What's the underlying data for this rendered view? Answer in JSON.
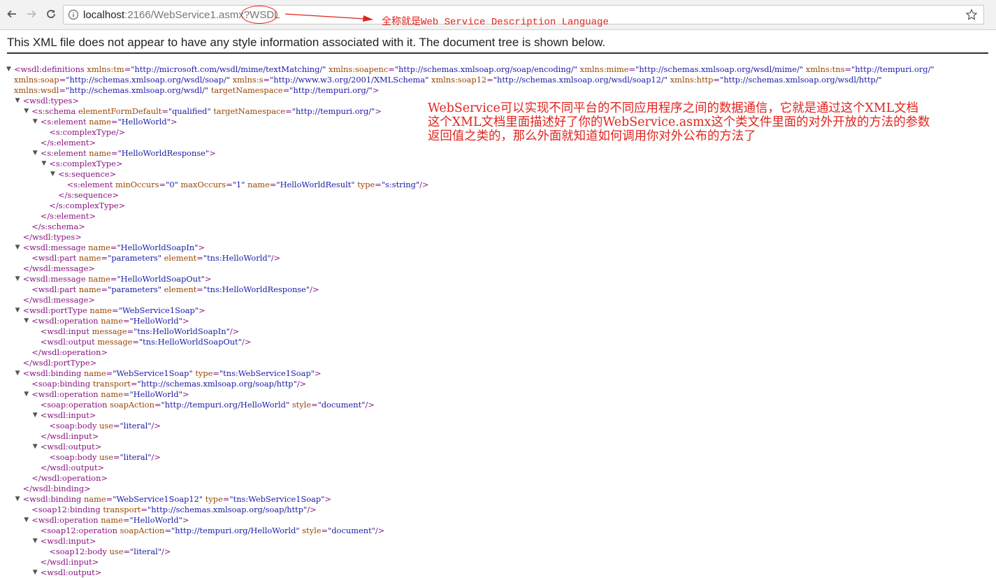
{
  "browser": {
    "url_host": "localhost",
    "url_rest": ":2166/WebService1.asmx?WSDL",
    "annotation": "全称就是Web Service Description Language"
  },
  "page": {
    "message": "This XML file does not appear to have any style information associated with it. The document tree is shown below."
  },
  "annotation": {
    "lines": [
      "WebService可以实现不同平台的不同应用程序之间的数据通信，它就是通过这个XML文档",
      "这个XML文档里面描述好了你的WebService.asmx这个类文件里面的对外开放的方法的参数",
      "返回值之类的，那么外面就知道如何调用你对外公布的方法了"
    ]
  },
  "xml_lines": [
    {
      "indent": 0,
      "toggle": true,
      "tag": "<wsdl:definitions",
      "attrs": [
        [
          "xmlns:tm",
          "http://microsoft.com/wsdl/mime/textMatching/"
        ],
        [
          "xmlns:soapenc",
          "http://schemas.xmlsoap.org/soap/encoding/"
        ],
        [
          "xmlns:mime",
          "http://schemas.xmlsoap.org/wsdl/mime/"
        ],
        [
          "xmlns:tns",
          "http://tempuri.org/"
        ]
      ],
      "end": ""
    },
    {
      "indent": 0,
      "toggle": false,
      "wrap": true,
      "tag": "",
      "attrs": [
        [
          "xmlns:soap",
          "http://schemas.xmlsoap.org/wsdl/soap/"
        ],
        [
          "xmlns:s",
          "http://www.w3.org/2001/XMLSchema"
        ],
        [
          "xmlns:soap12",
          "http://schemas.xmlsoap.org/wsdl/soap12/"
        ],
        [
          "xmlns:http",
          "http://schemas.xmlsoap.org/wsdl/http/"
        ]
      ],
      "end": ""
    },
    {
      "indent": 0,
      "toggle": false,
      "wrap": true,
      "tag": "",
      "attrs": [
        [
          "xmlns:wsdl",
          "http://schemas.xmlsoap.org/wsdl/"
        ],
        [
          "targetNamespace",
          "http://tempuri.org/"
        ]
      ],
      "end": ">"
    },
    {
      "indent": 1,
      "toggle": true,
      "tag": "<wsdl:types",
      "attrs": [],
      "end": ">"
    },
    {
      "indent": 2,
      "toggle": true,
      "tag": "<s:schema",
      "attrs": [
        [
          "elementFormDefault",
          "qualified"
        ],
        [
          "targetNamespace",
          "http://tempuri.org/"
        ]
      ],
      "end": ">"
    },
    {
      "indent": 3,
      "toggle": true,
      "tag": "<s:element",
      "attrs": [
        [
          "name",
          "HelloWorld"
        ]
      ],
      "end": ">"
    },
    {
      "indent": 4,
      "toggle": false,
      "tag": "<s:complexType/>",
      "attrs": [],
      "end": ""
    },
    {
      "indent": 3,
      "toggle": false,
      "tag": "</s:element>",
      "attrs": [],
      "end": ""
    },
    {
      "indent": 3,
      "toggle": true,
      "tag": "<s:element",
      "attrs": [
        [
          "name",
          "HelloWorldResponse"
        ]
      ],
      "end": ">"
    },
    {
      "indent": 4,
      "toggle": true,
      "tag": "<s:complexType",
      "attrs": [],
      "end": ">"
    },
    {
      "indent": 5,
      "toggle": true,
      "tag": "<s:sequence",
      "attrs": [],
      "end": ">"
    },
    {
      "indent": 6,
      "toggle": false,
      "tag": "<s:element",
      "attrs": [
        [
          "minOccurs",
          "0"
        ],
        [
          "maxOccurs",
          "1"
        ],
        [
          "name",
          "HelloWorldResult"
        ],
        [
          "type",
          "s:string"
        ]
      ],
      "end": "/>"
    },
    {
      "indent": 5,
      "toggle": false,
      "tag": "</s:sequence>",
      "attrs": [],
      "end": ""
    },
    {
      "indent": 4,
      "toggle": false,
      "tag": "</s:complexType>",
      "attrs": [],
      "end": ""
    },
    {
      "indent": 3,
      "toggle": false,
      "tag": "</s:element>",
      "attrs": [],
      "end": ""
    },
    {
      "indent": 2,
      "toggle": false,
      "tag": "</s:schema>",
      "attrs": [],
      "end": ""
    },
    {
      "indent": 1,
      "toggle": false,
      "tag": "</wsdl:types>",
      "attrs": [],
      "end": ""
    },
    {
      "indent": 1,
      "toggle": true,
      "tag": "<wsdl:message",
      "attrs": [
        [
          "name",
          "HelloWorldSoapIn"
        ]
      ],
      "end": ">"
    },
    {
      "indent": 2,
      "toggle": false,
      "tag": "<wsdl:part",
      "attrs": [
        [
          "name",
          "parameters"
        ],
        [
          "element",
          "tns:HelloWorld"
        ]
      ],
      "end": "/>"
    },
    {
      "indent": 1,
      "toggle": false,
      "tag": "</wsdl:message>",
      "attrs": [],
      "end": ""
    },
    {
      "indent": 1,
      "toggle": true,
      "tag": "<wsdl:message",
      "attrs": [
        [
          "name",
          "HelloWorldSoapOut"
        ]
      ],
      "end": ">"
    },
    {
      "indent": 2,
      "toggle": false,
      "tag": "<wsdl:part",
      "attrs": [
        [
          "name",
          "parameters"
        ],
        [
          "element",
          "tns:HelloWorldResponse"
        ]
      ],
      "end": "/>"
    },
    {
      "indent": 1,
      "toggle": false,
      "tag": "</wsdl:message>",
      "attrs": [],
      "end": ""
    },
    {
      "indent": 1,
      "toggle": true,
      "tag": "<wsdl:portType",
      "attrs": [
        [
          "name",
          "WebService1Soap"
        ]
      ],
      "end": ">"
    },
    {
      "indent": 2,
      "toggle": true,
      "tag": "<wsdl:operation",
      "attrs": [
        [
          "name",
          "HelloWorld"
        ]
      ],
      "end": ">"
    },
    {
      "indent": 3,
      "toggle": false,
      "tag": "<wsdl:input",
      "attrs": [
        [
          "message",
          "tns:HelloWorldSoapIn"
        ]
      ],
      "end": "/>"
    },
    {
      "indent": 3,
      "toggle": false,
      "tag": "<wsdl:output",
      "attrs": [
        [
          "message",
          "tns:HelloWorldSoapOut"
        ]
      ],
      "end": "/>"
    },
    {
      "indent": 2,
      "toggle": false,
      "tag": "</wsdl:operation>",
      "attrs": [],
      "end": ""
    },
    {
      "indent": 1,
      "toggle": false,
      "tag": "</wsdl:portType>",
      "attrs": [],
      "end": ""
    },
    {
      "indent": 1,
      "toggle": true,
      "tag": "<wsdl:binding",
      "attrs": [
        [
          "name",
          "WebService1Soap"
        ],
        [
          "type",
          "tns:WebService1Soap"
        ]
      ],
      "end": ">"
    },
    {
      "indent": 2,
      "toggle": false,
      "tag": "<soap:binding",
      "attrs": [
        [
          "transport",
          "http://schemas.xmlsoap.org/soap/http"
        ]
      ],
      "end": "/>"
    },
    {
      "indent": 2,
      "toggle": true,
      "tag": "<wsdl:operation",
      "attrs": [
        [
          "name",
          "HelloWorld"
        ]
      ],
      "end": ">"
    },
    {
      "indent": 3,
      "toggle": false,
      "tag": "<soap:operation",
      "attrs": [
        [
          "soapAction",
          "http://tempuri.org/HelloWorld"
        ],
        [
          "style",
          "document"
        ]
      ],
      "end": "/>"
    },
    {
      "indent": 3,
      "toggle": true,
      "tag": "<wsdl:input",
      "attrs": [],
      "end": ">"
    },
    {
      "indent": 4,
      "toggle": false,
      "tag": "<soap:body",
      "attrs": [
        [
          "use",
          "literal"
        ]
      ],
      "end": "/>"
    },
    {
      "indent": 3,
      "toggle": false,
      "tag": "</wsdl:input>",
      "attrs": [],
      "end": ""
    },
    {
      "indent": 3,
      "toggle": true,
      "tag": "<wsdl:output",
      "attrs": [],
      "end": ">"
    },
    {
      "indent": 4,
      "toggle": false,
      "tag": "<soap:body",
      "attrs": [
        [
          "use",
          "literal"
        ]
      ],
      "end": "/>"
    },
    {
      "indent": 3,
      "toggle": false,
      "tag": "</wsdl:output>",
      "attrs": [],
      "end": ""
    },
    {
      "indent": 2,
      "toggle": false,
      "tag": "</wsdl:operation>",
      "attrs": [],
      "end": ""
    },
    {
      "indent": 1,
      "toggle": false,
      "tag": "</wsdl:binding>",
      "attrs": [],
      "end": ""
    },
    {
      "indent": 1,
      "toggle": true,
      "tag": "<wsdl:binding",
      "attrs": [
        [
          "name",
          "WebService1Soap12"
        ],
        [
          "type",
          "tns:WebService1Soap"
        ]
      ],
      "end": ">"
    },
    {
      "indent": 2,
      "toggle": false,
      "tag": "<soap12:binding",
      "attrs": [
        [
          "transport",
          "http://schemas.xmlsoap.org/soap/http"
        ]
      ],
      "end": "/>"
    },
    {
      "indent": 2,
      "toggle": true,
      "tag": "<wsdl:operation",
      "attrs": [
        [
          "name",
          "HelloWorld"
        ]
      ],
      "end": ">"
    },
    {
      "indent": 3,
      "toggle": false,
      "tag": "<soap12:operation",
      "attrs": [
        [
          "soapAction",
          "http://tempuri.org/HelloWorld"
        ],
        [
          "style",
          "document"
        ]
      ],
      "end": "/>"
    },
    {
      "indent": 3,
      "toggle": true,
      "tag": "<wsdl:input",
      "attrs": [],
      "end": ">"
    },
    {
      "indent": 4,
      "toggle": false,
      "tag": "<soap12:body",
      "attrs": [
        [
          "use",
          "literal"
        ]
      ],
      "end": "/>"
    },
    {
      "indent": 3,
      "toggle": false,
      "tag": "</wsdl:input>",
      "attrs": [],
      "end": ""
    },
    {
      "indent": 3,
      "toggle": true,
      "tag": "<wsdl:output",
      "attrs": [],
      "end": ">"
    }
  ]
}
